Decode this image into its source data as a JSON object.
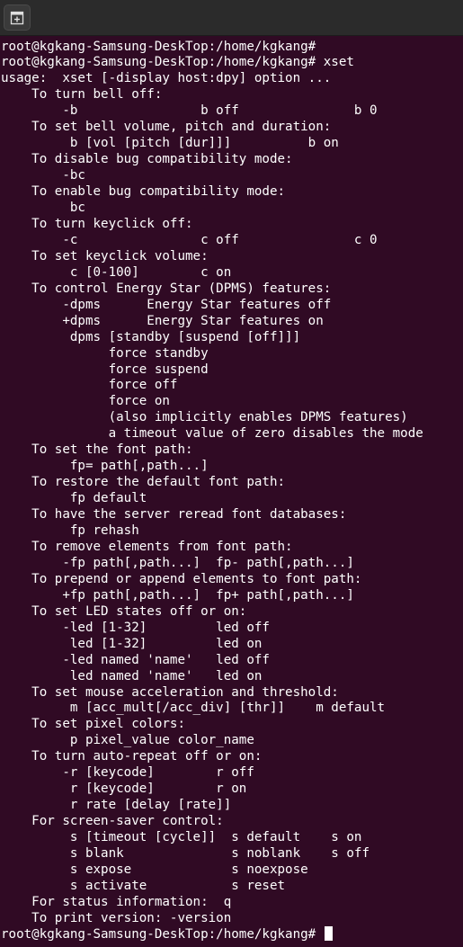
{
  "window": {
    "new_tab_icon": "new-tab-icon"
  },
  "terminal": {
    "lines": [
      "root@kgkang-Samsung-DeskTop:/home/kgkang#",
      "root@kgkang-Samsung-DeskTop:/home/kgkang# xset",
      "usage:  xset [-display host:dpy] option ...",
      "    To turn bell off:",
      "        -b                b off               b 0",
      "    To set bell volume, pitch and duration:",
      "         b [vol [pitch [dur]]]          b on",
      "    To disable bug compatibility mode:",
      "        -bc",
      "    To enable bug compatibility mode:",
      "         bc",
      "    To turn keyclick off:",
      "        -c                c off               c 0",
      "    To set keyclick volume:",
      "         c [0-100]        c on",
      "    To control Energy Star (DPMS) features:",
      "        -dpms      Energy Star features off",
      "        +dpms      Energy Star features on",
      "         dpms [standby [suspend [off]]]",
      "              force standby",
      "              force suspend",
      "              force off",
      "              force on",
      "              (also implicitly enables DPMS features)",
      "              a timeout value of zero disables the mode",
      "    To set the font path:",
      "         fp= path[,path...]",
      "    To restore the default font path:",
      "         fp default",
      "    To have the server reread font databases:",
      "         fp rehash",
      "    To remove elements from font path:",
      "        -fp path[,path...]  fp- path[,path...]",
      "    To prepend or append elements to font path:",
      "        +fp path[,path...]  fp+ path[,path...]",
      "    To set LED states off or on:",
      "        -led [1-32]         led off",
      "         led [1-32]         led on",
      "        -led named 'name'   led off",
      "         led named 'name'   led on",
      "    To set mouse acceleration and threshold:",
      "         m [acc_mult[/acc_div] [thr]]    m default",
      "    To set pixel colors:",
      "         p pixel_value color_name",
      "    To turn auto-repeat off or on:",
      "        -r [keycode]        r off",
      "         r [keycode]        r on",
      "         r rate [delay [rate]]",
      "    For screen-saver control:",
      "         s [timeout [cycle]]  s default    s on",
      "         s blank              s noblank    s off",
      "         s expose             s noexpose",
      "         s activate           s reset",
      "    For status information:  q",
      "    To print version: -version",
      "root@kgkang-Samsung-DeskTop:/home/kgkang# "
    ]
  }
}
